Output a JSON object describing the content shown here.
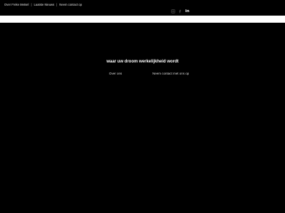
{
  "topnav": {
    "items": [
      "Over Freke Metsel",
      "Laatste Nieuws",
      "Neem contact op"
    ],
    "separator": "|"
  },
  "social": {
    "icons": [
      "instagram-icon",
      "facebook-icon",
      "linkedin-icon"
    ],
    "linkedin_label": "in"
  },
  "hero": {
    "headline": "waar uw droom werkelijkheid wordt",
    "buttons": {
      "about": "Over ons",
      "contact": "Neem contact met ons op"
    }
  },
  "colors": {
    "background": "#000000",
    "bar": "#ffffff",
    "text": "#ffffff"
  }
}
